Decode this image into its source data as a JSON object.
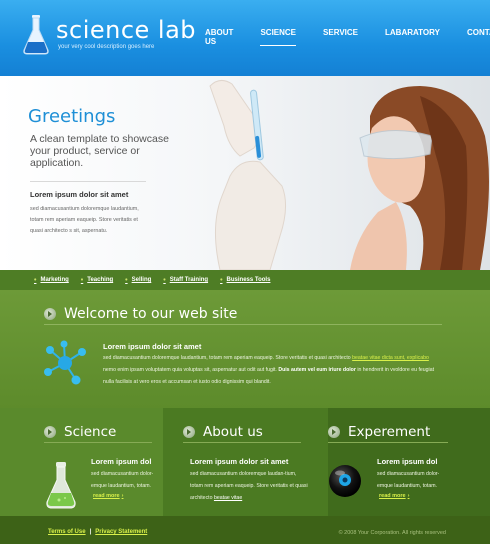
{
  "brand": {
    "name": "science lab",
    "tagline": "your very cool description goes here"
  },
  "nav": {
    "items": [
      "ABOUT US",
      "SCIENCE",
      "SERVICE",
      "LABARATORY",
      "CONTACTS"
    ],
    "active": "SCIENCE"
  },
  "hero": {
    "title": "Greetings",
    "subtitle": "A clean template to showcase your product, service or application.",
    "heading": "Lorem ipsum dolor sit amet",
    "text": "sed diamacusantium doloremque laudantium, totam rem aperiam eaqueip. Store veritatis et quasi architecto s sit, aspernatu."
  },
  "subnav": {
    "items": [
      "Marketing",
      "Teaching",
      "Selling",
      "Staff Training",
      "Business Tools"
    ]
  },
  "welcome": {
    "title": "Welcome to our web site",
    "heading": "Lorem ipsum dolor sit amet",
    "text_a": "sed diamacusantium doloremque laudantium, totam rem aperiam eaqueip. Store veritatis et quasi architecto ",
    "link": "beatae vitae dicta sunt, explicabo",
    "text_b": " nemo enim ipsam voluptatem quia voluptas sit, aspernatur aut odit aut fugit. ",
    "bold": "Duis autem vel eum iriure dolor",
    "text_c": " in hendrerit in vvoldore eu feugiat nulla facilisis at vero eros et accumsan et iusto odio dignissim qui blandit."
  },
  "columns": [
    {
      "title": "Science",
      "heading": "Lorem ipsum dol",
      "text": "sed diamacusantium dolor-emque laudantium, totam.",
      "more": "read more"
    },
    {
      "title": "About us",
      "heading": "Lorem ipsum dolor sit amet",
      "text_a": "sed diamacusantium doloremque laudan-tium, totam rem aperiam eaqueip. Store veritatis et quasi architecto ",
      "link": "beatae vitae"
    },
    {
      "title": "Experement",
      "heading": "Lorem ipsum dol",
      "text": "sed diamacusantium dolor-emque laudantium, totam.",
      "more": "read more"
    }
  ],
  "footer": {
    "terms": "Terms of Use",
    "separator": "|",
    "privacy": "Privacy Statement",
    "copyright": "© 2008 Your Corporation. All rights reserved"
  },
  "colors": {
    "header_blue": "#1a8fe0",
    "green_dark": "#3d6217",
    "green_mid": "#5d8b2b",
    "accent_lime": "#d9f04a"
  }
}
